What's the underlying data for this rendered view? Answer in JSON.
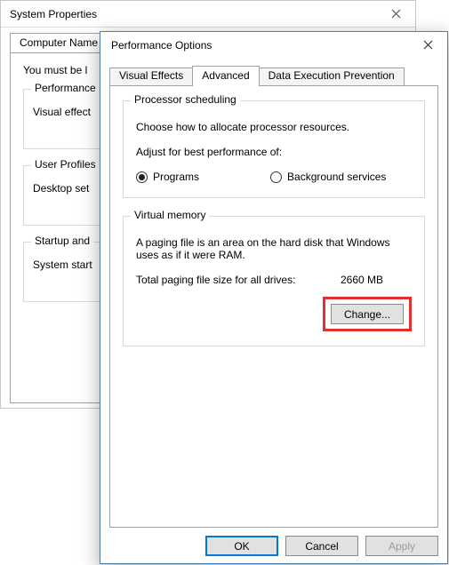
{
  "sysprop": {
    "title": "System Properties",
    "tab_visible": "Computer Name",
    "note": "You must be l",
    "groups": {
      "performance": {
        "legend": "Performance",
        "desc": "Visual effect"
      },
      "user_profiles": {
        "legend": "User Profiles",
        "desc": "Desktop set"
      },
      "startup": {
        "legend": "Startup and",
        "desc": "System start"
      }
    }
  },
  "perf": {
    "title": "Performance Options",
    "tabs": {
      "visual_effects": "Visual Effects",
      "advanced": "Advanced",
      "dep": "Data Execution Prevention"
    },
    "processor_scheduling": {
      "legend": "Processor scheduling",
      "desc": "Choose how to allocate processor resources.",
      "adjust_label": "Adjust for best performance of:",
      "options": {
        "programs": "Programs",
        "background": "Background services"
      },
      "selected": "programs"
    },
    "virtual_memory": {
      "legend": "Virtual memory",
      "desc": "A paging file is an area on the hard disk that Windows uses as if it were RAM.",
      "total_label": "Total paging file size for all drives:",
      "total_value": "2660 MB",
      "change_button": "Change..."
    },
    "footer": {
      "ok": "OK",
      "cancel": "Cancel",
      "apply": "Apply"
    }
  }
}
